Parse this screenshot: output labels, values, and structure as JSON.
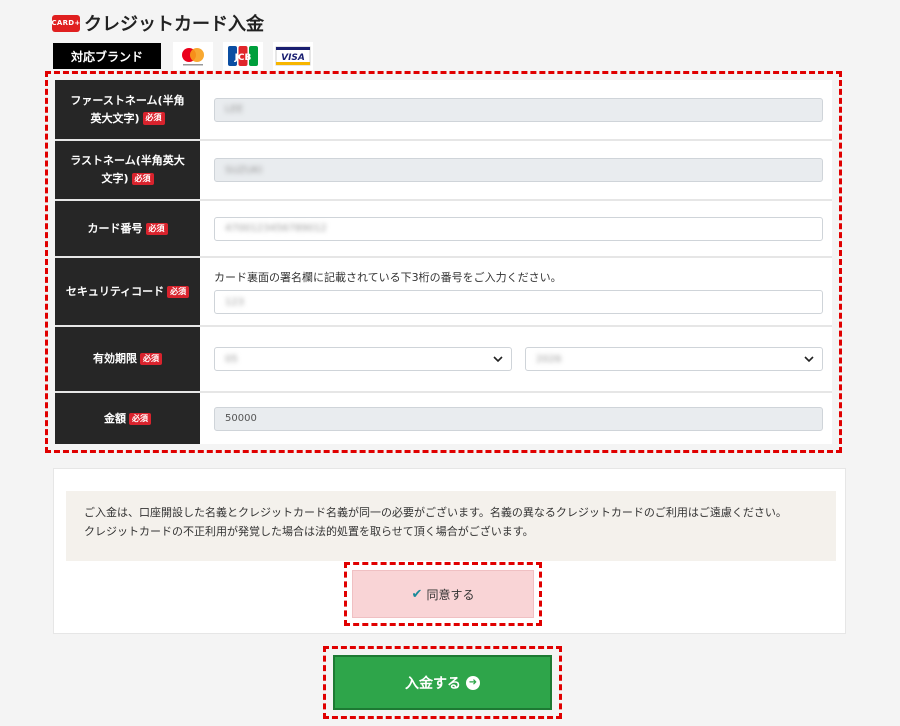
{
  "header": {
    "icon_text": "CARD+",
    "title": "クレジットカード入金"
  },
  "brands": {
    "label": "対応ブランド",
    "logos": [
      "mastercard-logo",
      "jcb-logo",
      "visa-logo"
    ],
    "visa_text": "VISA",
    "jcb_text": "JCB"
  },
  "required_badge": "必須",
  "form": {
    "first_name": {
      "label": "ファーストネーム(半角英大文字)",
      "value": "LEE"
    },
    "last_name": {
      "label": "ラストネーム(半角英大文字)",
      "value": "SUZUKI"
    },
    "card_number": {
      "label": "カード番号",
      "value": "4700123456789012"
    },
    "security_code": {
      "label": "セキュリティコード",
      "hint": "カード裏面の署名欄に記載されている下3桁の番号をご入力ください。",
      "value": "123"
    },
    "expiry": {
      "label": "有効期限",
      "month": "05",
      "year": "2026"
    },
    "amount": {
      "label": "金額",
      "value": "50000"
    }
  },
  "notice": {
    "line1": "ご入金は、口座開設した名義とクレジットカード名義が同一の必要がございます。名義の異なるクレジットカードのご利用はご遠慮ください。",
    "line2": "クレジットカードの不正利用が発覚した場合は法的処置を取らせて頂く場合がございます。"
  },
  "agree_button": {
    "label": "同意する"
  },
  "submit_button": {
    "label": "入金する"
  },
  "colors": {
    "accent_red": "#e00000",
    "submit_green": "#2ea54a",
    "label_bg": "#262626"
  }
}
